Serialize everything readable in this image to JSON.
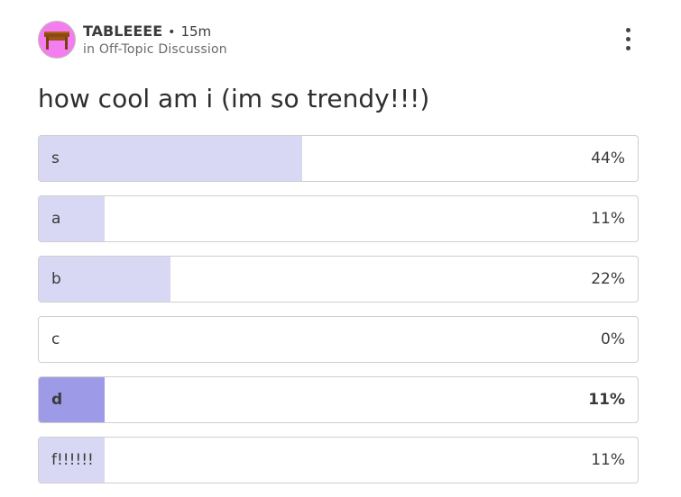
{
  "post": {
    "author": "TABLEEEE",
    "separator": "•",
    "time": "15m",
    "community": "in Off-Topic Discussion",
    "title": "how cool am i (im so trendy!!!)",
    "avatar_icon": "table-icon",
    "avatar_color": "#f47ef0",
    "more_icon": "more-vertical-icon"
  },
  "poll": {
    "fill_color": "#d8d8f5",
    "selected_fill_color": "#9d9be8",
    "options": [
      {
        "label": "s",
        "percent_text": "44%",
        "percent": 44,
        "selected": false
      },
      {
        "label": "a",
        "percent_text": "11%",
        "percent": 11,
        "selected": false
      },
      {
        "label": "b",
        "percent_text": "22%",
        "percent": 22,
        "selected": false
      },
      {
        "label": "c",
        "percent_text": "0%",
        "percent": 0,
        "selected": false
      },
      {
        "label": "d",
        "percent_text": "11%",
        "percent": 11,
        "selected": true
      },
      {
        "label": "f!!!!!!",
        "percent_text": "11%",
        "percent": 11,
        "selected": false
      }
    ]
  }
}
